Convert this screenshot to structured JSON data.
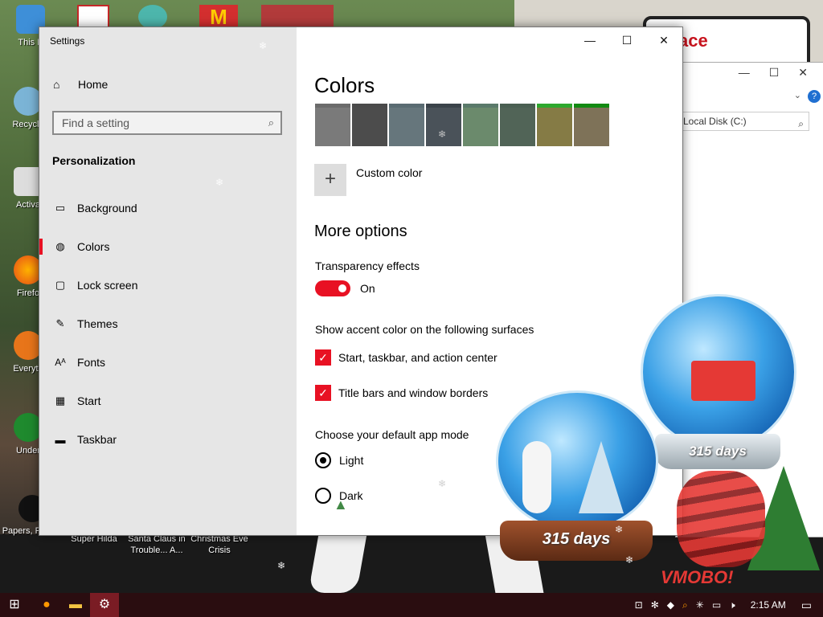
{
  "desktop": {
    "icons": [
      {
        "label": "This P"
      },
      {
        "label": "Recycle"
      },
      {
        "label": "Activa"
      },
      {
        "label": "Firefo"
      },
      {
        "label": "Everyth"
      },
      {
        "label": "Under"
      },
      {
        "label": "Papers, Please"
      },
      {
        "label": "Super Hilda"
      },
      {
        "label": "Santa Claus in Trouble... A..."
      },
      {
        "label": "Christmas Eve Crisis"
      }
    ],
    "sign_text": "ace",
    "globe_counter_1": "315 days",
    "globe_counter_2": "315 days",
    "watermark": "VMOBO!"
  },
  "explorer": {
    "address": "Local Disk (C:)",
    "help": "?"
  },
  "settings": {
    "window_title": "Settings",
    "controls": {
      "minimize": "—",
      "maximize": "☐",
      "close": "✕"
    },
    "sidebar": {
      "home_label": "Home",
      "search_placeholder": "Find a setting",
      "section_title": "Personalization",
      "items": [
        {
          "label": "Background",
          "icon": "picture-icon"
        },
        {
          "label": "Colors",
          "icon": "palette-icon",
          "active": true
        },
        {
          "label": "Lock screen",
          "icon": "lock-screen-icon"
        },
        {
          "label": "Themes",
          "icon": "brush-icon"
        },
        {
          "label": "Fonts",
          "icon": "fonts-icon"
        },
        {
          "label": "Start",
          "icon": "start-icon"
        },
        {
          "label": "Taskbar",
          "icon": "taskbar-icon"
        }
      ]
    },
    "content": {
      "page_title": "Colors",
      "swatches": [
        {
          "top": "#6b6b6b",
          "fill": "#7a7a7a"
        },
        {
          "top": "#4a4a4a",
          "fill": "#4c4c4c"
        },
        {
          "top": "#5a6b72",
          "fill": "#66767c"
        },
        {
          "top": "#3b434a",
          "fill": "#4a5259"
        },
        {
          "top": "#5a7a6a",
          "fill": "#6b8a6c"
        },
        {
          "top": "#4a5f52",
          "fill": "#516457"
        },
        {
          "top": "#2ea82e",
          "fill": "#857b45"
        },
        {
          "top": "#128a12",
          "fill": "#7e7258"
        }
      ],
      "custom_color_label": "Custom color",
      "more_options_title": "More options",
      "transparency_label": "Transparency effects",
      "transparency_state": "On",
      "accent_surfaces_label": "Show accent color on the following surfaces",
      "checkbox_start": "Start, taskbar, and action center",
      "checkbox_titlebars": "Title bars and window borders",
      "app_mode_label": "Choose your default app mode",
      "radio_light": "Light",
      "radio_dark": "Dark"
    }
  },
  "taskbar": {
    "time": "2:15 AM"
  },
  "colors": {
    "accent": "#e81123",
    "taskbar": "#2a0d10"
  }
}
